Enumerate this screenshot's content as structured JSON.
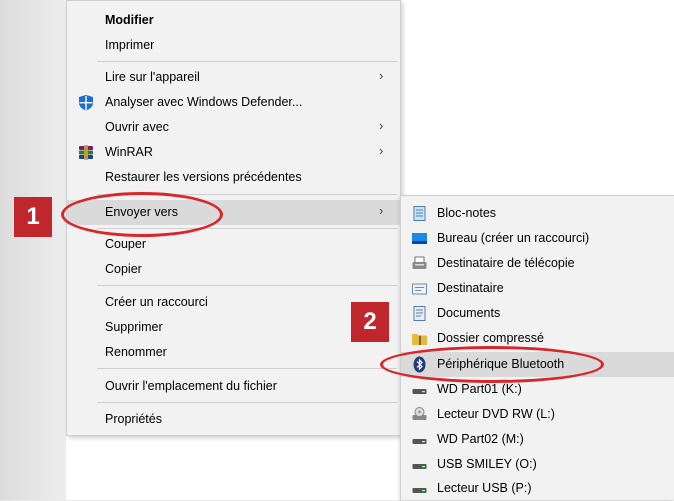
{
  "menu": {
    "items": [
      {
        "label": "Modifier",
        "bold": true
      },
      {
        "label": "Imprimer"
      },
      {
        "label": "Lire sur l'appareil",
        "submenu": true
      },
      {
        "label": "Analyser avec Windows Defender...",
        "icon": "windows-defender-icon"
      },
      {
        "label": "Ouvrir avec",
        "submenu": true
      },
      {
        "label": "WinRAR",
        "icon": "winrar-icon",
        "submenu": true
      },
      {
        "label": "Restaurer les versions précédentes"
      },
      {
        "label": "Envoyer vers",
        "submenu": true,
        "highlighted": true
      },
      {
        "label": "Couper"
      },
      {
        "label": "Copier"
      },
      {
        "label": "Créer un raccourci"
      },
      {
        "label": "Supprimer"
      },
      {
        "label": "Renommer"
      },
      {
        "label": "Ouvrir l'emplacement du fichier"
      },
      {
        "label": "Propriétés"
      }
    ]
  },
  "submenu": {
    "items": [
      {
        "label": "Bloc-notes",
        "icon": "notepad-icon"
      },
      {
        "label": "Bureau (créer un raccourci)",
        "icon": "desktop-icon"
      },
      {
        "label": "Destinataire de télécopie",
        "icon": "fax-icon"
      },
      {
        "label": "Destinataire",
        "icon": "mail-recipient-icon"
      },
      {
        "label": "Documents",
        "icon": "documents-icon"
      },
      {
        "label": "Dossier compressé",
        "icon": "zip-folder-icon"
      },
      {
        "label": "Périphérique Bluetooth",
        "icon": "bluetooth-icon",
        "highlighted": true
      },
      {
        "label": "WD Part01 (K:)",
        "icon": "drive-icon"
      },
      {
        "label": "Lecteur DVD RW (L:)",
        "icon": "dvd-drive-icon"
      },
      {
        "label": "WD Part02 (M:)",
        "icon": "drive-icon"
      },
      {
        "label": "USB SMILEY (O:)",
        "icon": "drive-icon"
      },
      {
        "label": "Lecteur USB (P:)",
        "icon": "drive-icon"
      }
    ]
  },
  "annotations": {
    "step1": "1",
    "step2": "2",
    "accent_color": "#c0272d"
  },
  "chevron": "›"
}
